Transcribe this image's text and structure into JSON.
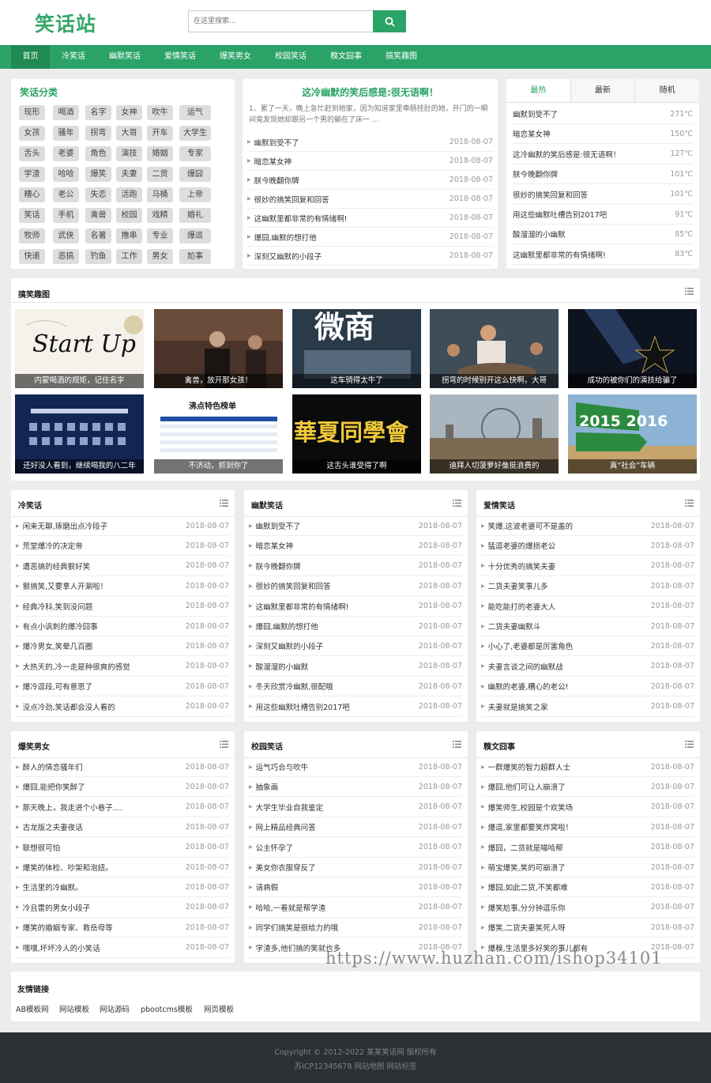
{
  "logo": "笑话站",
  "search": {
    "placeholder": "在这里搜索..."
  },
  "nav": [
    "首页",
    "冷笑话",
    "幽默笑话",
    "爱情笑话",
    "爆笑男女",
    "校园笑话",
    "糗文囧事",
    "搞笑趣图"
  ],
  "categories": {
    "title": "笑话分类",
    "tags": [
      "现形",
      "喝酒",
      "名字",
      "女神",
      "吹牛",
      "运气",
      "女孩",
      "骚年",
      "拐弯",
      "大哥",
      "开车",
      "大学生",
      "舌头",
      "老婆",
      "角色",
      "演技",
      "婚姻",
      "专家",
      "学渣",
      "哈哈",
      "爆笑",
      "夫妻",
      "二货",
      "爆囧",
      "糟心",
      "老公",
      "失恋",
      "活跑",
      "马桶",
      "上帝",
      "笑话",
      "手机",
      "禽兽",
      "校园",
      "戏精",
      "婚礼",
      "牧师",
      "武侠",
      "名著",
      "撸串",
      "专业",
      "爆逗",
      "快递",
      "恶搞",
      "钓鱼",
      "工作",
      "男女",
      "尬事"
    ]
  },
  "featured": {
    "title": "这冷幽默的笑后感是:很无语啊！",
    "desc": "1、累了一天，晚上急忙赶到她家，因为知道家里牵肠挂肚的她，开门的一瞬间竟发现她却跟另一个男的躺在了床一 ...",
    "items": [
      {
        "title": "幽默到受不了",
        "date": "2018-08-07"
      },
      {
        "title": "暗恋某女神",
        "date": "2018-08-07"
      },
      {
        "title": "朕今晚翻你牌",
        "date": "2018-08-07"
      },
      {
        "title": "很妙的搞笑回复和回答",
        "date": "2018-08-07"
      },
      {
        "title": "这幽默里都非常的有情绪啊!",
        "date": "2018-08-07"
      },
      {
        "title": "爆囧,幽默的想打他",
        "date": "2018-08-07"
      },
      {
        "title": "深刻又幽默的小段子",
        "date": "2018-08-07"
      }
    ]
  },
  "hot": {
    "tabs": [
      "最热",
      "最新",
      "随机"
    ],
    "items": [
      {
        "title": "幽默到受不了",
        "heat": "271℃"
      },
      {
        "title": "暗恋某女神",
        "heat": "150℃"
      },
      {
        "title": "这冷幽默的笑后感是:很无语啊！",
        "heat": "127℃"
      },
      {
        "title": "朕今晚翻你牌",
        "heat": "101℃"
      },
      {
        "title": "很妙的搞笑回复和回答",
        "heat": "101℃"
      },
      {
        "title": "用这些幽默吐槽告别2017吧",
        "heat": "91℃"
      },
      {
        "title": "酸溜溜的小幽默",
        "heat": "85℃"
      },
      {
        "title": "这幽默里都非常的有情绪啊!",
        "heat": "83℃"
      }
    ]
  },
  "gallery": {
    "title": "搞笑趣图",
    "items": [
      {
        "caption": "内蒙喝酒的规矩，记住名字",
        "picture_text": "Start Up"
      },
      {
        "caption": "禽兽，放开那女孩！",
        "picture_text": ""
      },
      {
        "caption": "这车骑得太牛了",
        "picture_text": "微商"
      },
      {
        "caption": "拐弯的时候别开这么快啊，大哥",
        "picture_text": ""
      },
      {
        "caption": "成功的被你们的演技给骗了",
        "picture_text": ""
      },
      {
        "caption": "还好没人看到，继续喝我的八二年",
        "picture_text": ""
      },
      {
        "caption": "不济动，抓到你了",
        "picture_text": "沸点特色榜单"
      },
      {
        "caption": "这舌头谁受得了啊",
        "picture_text": "華夏同學會"
      },
      {
        "caption": "迪拜人切菠萝好像挺浪费的",
        "picture_text": ""
      },
      {
        "caption": "真“社会”车辆",
        "picture_text": "2015 2016"
      }
    ]
  },
  "sections": [
    {
      "title": "冷笑话",
      "items": [
        {
          "title": "闲来无聊,琢磨出点冷段子",
          "date": "2018-08-07"
        },
        {
          "title": "荒堂爆冷的决定帝",
          "date": "2018-08-07"
        },
        {
          "title": "遭恶搞的经典狠好笑",
          "date": "2018-08-07"
        },
        {
          "title": "狠搞笑,又要拿人开涮啦！",
          "date": "2018-08-07"
        },
        {
          "title": "经典冷科,笑到没问题",
          "date": "2018-08-07"
        },
        {
          "title": "有点小讽刺的爆冷囧事",
          "date": "2018-08-07"
        },
        {
          "title": "爆冷男女,笑晕几百圈",
          "date": "2018-08-07"
        },
        {
          "title": "大热天的,冷一走是种很爽的感觉",
          "date": "2018-08-07"
        },
        {
          "title": "爆冷逗段,可有意思了",
          "date": "2018-08-07"
        },
        {
          "title": "没点冷劲,笑话都会没人看的",
          "date": "2018-08-07"
        }
      ]
    },
    {
      "title": "幽默笑话",
      "items": [
        {
          "title": "幽默到受不了",
          "date": "2018-08-07"
        },
        {
          "title": "暗恋某女神",
          "date": "2018-08-07"
        },
        {
          "title": "朕今晚翻你牌",
          "date": "2018-08-07"
        },
        {
          "title": "很妙的搞笑回复和回答",
          "date": "2018-08-07"
        },
        {
          "title": "这幽默里都非常的有情绪啊!",
          "date": "2018-08-07"
        },
        {
          "title": "爆囧,幽默的想打他",
          "date": "2018-08-07"
        },
        {
          "title": "深刻又幽默的小段子",
          "date": "2018-08-07"
        },
        {
          "title": "酸溜溜的小幽默",
          "date": "2018-08-07"
        },
        {
          "title": "冬天欣赏冷幽默,很配哦",
          "date": "2018-08-07"
        },
        {
          "title": "用这些幽默吐槽告别2017吧",
          "date": "2018-08-07"
        }
      ]
    },
    {
      "title": "爱情笑话",
      "items": [
        {
          "title": "笑爆,这波老婆可不是盖的",
          "date": "2018-08-07"
        },
        {
          "title": "猛逗老婆的爆损老公",
          "date": "2018-08-07"
        },
        {
          "title": "十分优秀的搞笑夫妻",
          "date": "2018-08-07"
        },
        {
          "title": "二货夫妻笑事儿多",
          "date": "2018-08-07"
        },
        {
          "title": "能吃能打的老婆大人",
          "date": "2018-08-07"
        },
        {
          "title": "二货夫妻幽默斗",
          "date": "2018-08-07"
        },
        {
          "title": "小心了,老婆都是厉害角色",
          "date": "2018-08-07"
        },
        {
          "title": "夫妻言谈之间的幽默战",
          "date": "2018-08-07"
        },
        {
          "title": "幽默的老婆,糟心的老公!",
          "date": "2018-08-07"
        },
        {
          "title": "夫妻就是搞笑之家",
          "date": "2018-08-07"
        }
      ]
    },
    {
      "title": "爆笑男女",
      "items": [
        {
          "title": "醉人的情恋骚年们",
          "date": "2018-08-07"
        },
        {
          "title": "爆囧,能把你笑醉了",
          "date": "2018-08-07"
        },
        {
          "title": "那天晚上，我走进个小巷子....",
          "date": "2018-08-07"
        },
        {
          "title": "古龙版之夫妻夜话",
          "date": "2018-08-07"
        },
        {
          "title": "联想很可怕",
          "date": "2018-08-07"
        },
        {
          "title": "爆笑的体检、吵架和泡妞。",
          "date": "2018-08-07"
        },
        {
          "title": "生活里的冷幽默。",
          "date": "2018-08-07"
        },
        {
          "title": "冷且雷的男女小段子",
          "date": "2018-08-07"
        },
        {
          "title": "爆笑的婚姻专家、救岳母等",
          "date": "2018-08-07"
        },
        {
          "title": "嘿嘿,坏坏冷人的小笑话",
          "date": "2018-08-07"
        }
      ]
    },
    {
      "title": "校园笑话",
      "items": [
        {
          "title": "运气巧合与吹牛",
          "date": "2018-08-07"
        },
        {
          "title": "抽象画",
          "date": "2018-08-07"
        },
        {
          "title": "大学生毕业自我鉴定",
          "date": "2018-08-07"
        },
        {
          "title": "网上精品经典问答",
          "date": "2018-08-07"
        },
        {
          "title": "公主怀孕了",
          "date": "2018-08-07"
        },
        {
          "title": "美女你衣服穿反了",
          "date": "2018-08-07"
        },
        {
          "title": "请病假",
          "date": "2018-08-07"
        },
        {
          "title": "哈哈,一看就是帮学渣",
          "date": "2018-08-07"
        },
        {
          "title": "同学们搞笑是很给力的哦",
          "date": "2018-08-07"
        },
        {
          "title": "学渣多,他们搞的笑就也多",
          "date": "2018-08-07"
        }
      ]
    },
    {
      "title": "糗文囧事",
      "items": [
        {
          "title": "一群爆笑的智力超群人士",
          "date": "2018-08-07"
        },
        {
          "title": "爆囧,他们可让人崩溃了",
          "date": "2018-08-07"
        },
        {
          "title": "爆笑师生,校园是个欢笑场",
          "date": "2018-08-07"
        },
        {
          "title": "爆逗,家里都要笑炸窝啦！",
          "date": "2018-08-07"
        },
        {
          "title": "爆囧，二货就是喵哈帮",
          "date": "2018-08-07"
        },
        {
          "title": "萌宝爆笑,笑的可崩溃了",
          "date": "2018-08-07"
        },
        {
          "title": "爆囧,如此二货,不笑都难",
          "date": "2018-08-07"
        },
        {
          "title": "爆笑尬事,分分钟逗乐你",
          "date": "2018-08-07"
        },
        {
          "title": "爆笑,二货夫妻笑死人呀",
          "date": "2018-08-07"
        },
        {
          "title": "爆糗,生活里多好笑的事儿都有",
          "date": "2018-08-07"
        }
      ]
    }
  ],
  "friends": {
    "title": "友情链接",
    "links": [
      "AB模板网",
      "网站模板",
      "网站源码",
      "pbootcms模板",
      "网页模板"
    ]
  },
  "footer": {
    "copyright": "Copyright © 2012-2022 某某笑话网 版权所有",
    "icp": "苏ICP12345678 网站地图 网站标签"
  },
  "watermark": "https://www.huzhan.com/ishop34101",
  "colors": {
    "brand": "#2ba366",
    "nav_active": "#1f8a52",
    "footer_bg": "#2d3033"
  }
}
